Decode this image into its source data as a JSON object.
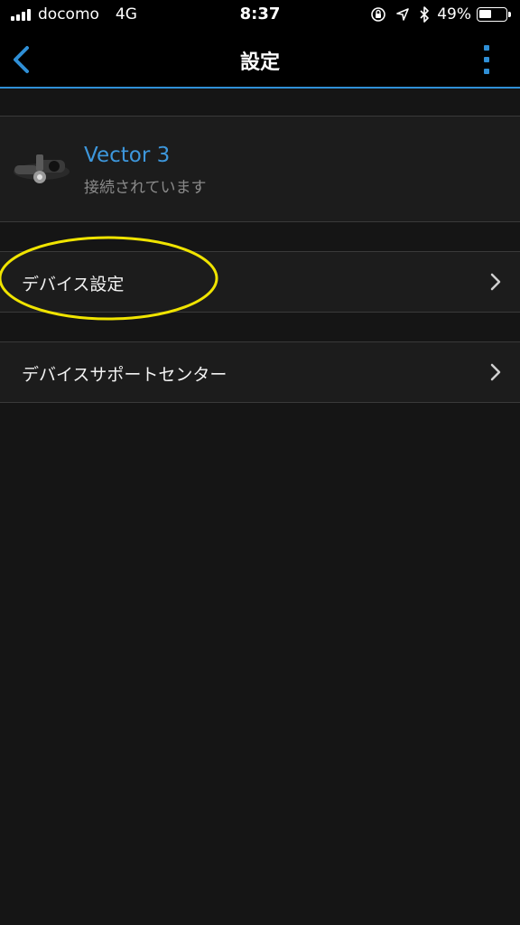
{
  "status_bar": {
    "carrier": "docomo",
    "network": "4G",
    "time": "8:37",
    "battery_percent": "49%",
    "battery_level": 0.49,
    "icons": [
      "signal-bars-icon",
      "orientation-lock-icon",
      "location-arrow-icon",
      "bluetooth-icon",
      "battery-icon"
    ]
  },
  "nav": {
    "title": "設定",
    "back_icon": "chevron-left-icon",
    "more_icon": "vertical-dots-icon",
    "accent_color": "#2f8fd6"
  },
  "device": {
    "name": "Vector 3",
    "status": "接続されています",
    "image": "pedal-sensor-image"
  },
  "menu": {
    "items": [
      {
        "label": "デバイス設定",
        "icon": "chevron-right-icon",
        "highlighted": true
      },
      {
        "label": "デバイスサポートセンター",
        "icon": "chevron-right-icon"
      }
    ]
  },
  "colors": {
    "background": "#151515",
    "row_background": "#1c1c1c",
    "accent": "#2f8fd6",
    "device_name": "#3d97dc",
    "annotation": "#f0e400"
  }
}
